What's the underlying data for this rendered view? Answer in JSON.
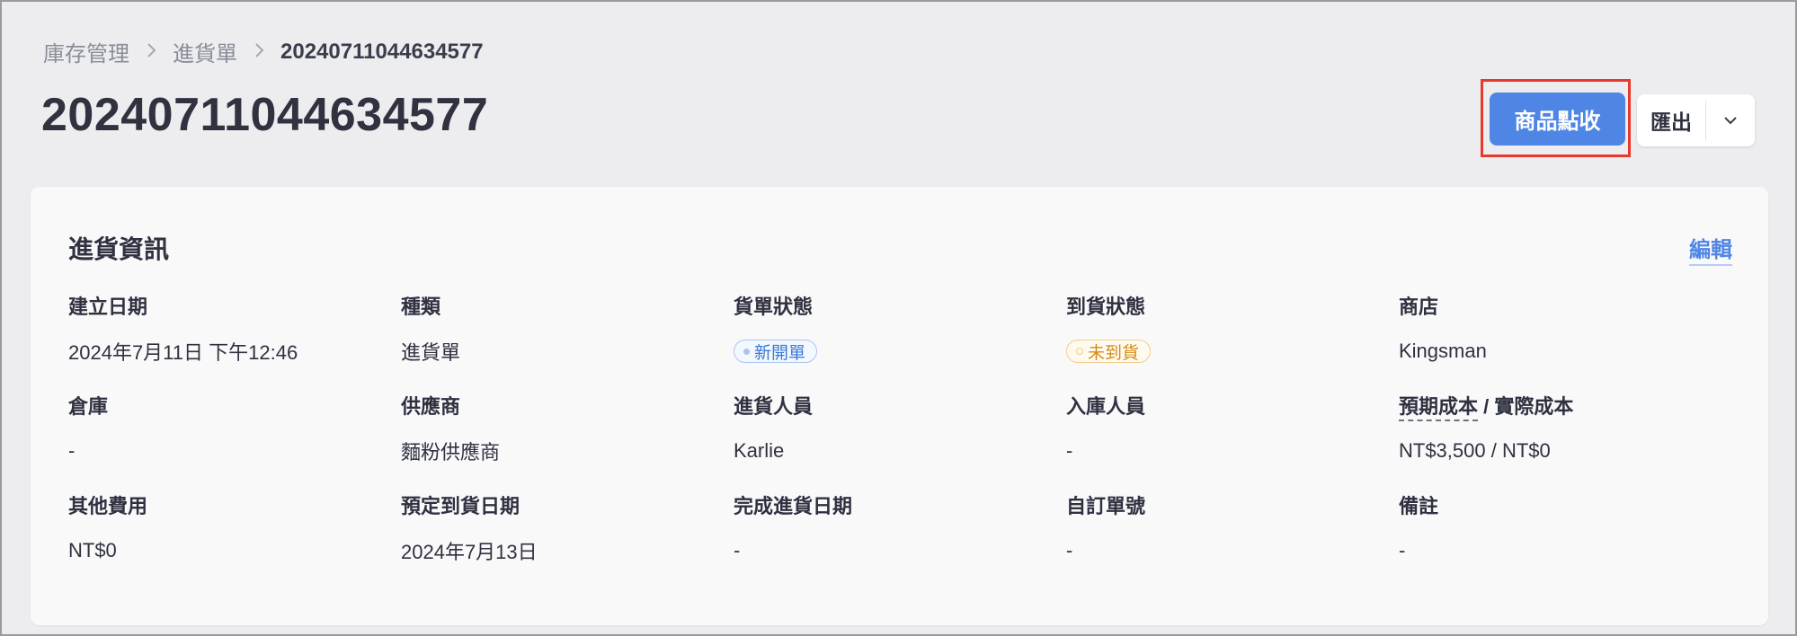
{
  "breadcrumb": {
    "items": [
      "庫存管理",
      "進貨單",
      "20240711044634577"
    ]
  },
  "header": {
    "title": "20240711044634577",
    "receive_button": "商品點收",
    "export_button": "匯出"
  },
  "card": {
    "title": "進貨資訊",
    "edit_link": "編輯",
    "fields": [
      {
        "label": "建立日期",
        "value": "2024年7月11日 下午12:46"
      },
      {
        "label": "種類",
        "value": "進貨單"
      },
      {
        "label": "貨單狀態",
        "value": "新開單"
      },
      {
        "label": "到貨狀態",
        "value": "未到貨"
      },
      {
        "label": "商店",
        "value": "Kingsman"
      },
      {
        "label": "倉庫",
        "value": "-"
      },
      {
        "label": "供應商",
        "value": "麵粉供應商"
      },
      {
        "label": "進貨人員",
        "value": "Karlie"
      },
      {
        "label": "入庫人員",
        "value": "-"
      },
      {
        "label_a": "預期成本",
        "label_sep": " / ",
        "label_b": "實際成本",
        "value": "NT$3,500 / NT$0"
      },
      {
        "label": "其他費用",
        "value": "NT$0"
      },
      {
        "label": "預定到貨日期",
        "value": "2024年7月13日"
      },
      {
        "label": "完成進貨日期",
        "value": "-"
      },
      {
        "label": "自訂單號",
        "value": "-"
      },
      {
        "label": "備註",
        "value": "-"
      }
    ]
  },
  "colors": {
    "accent": "#4f86e6",
    "highlight": "#e8392c",
    "status_blue": "#3c79d8",
    "status_orange": "#d48b13"
  }
}
